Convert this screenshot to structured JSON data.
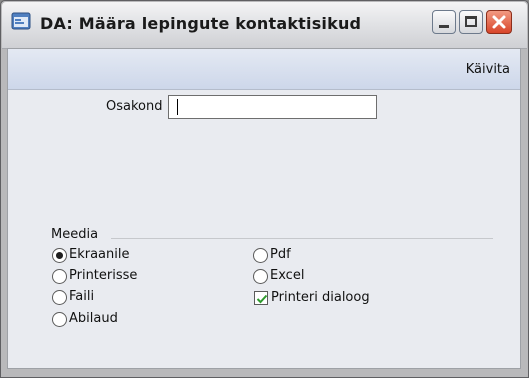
{
  "window": {
    "title": "DA: Määra lepingute kontaktisikud",
    "icon": "app-window-icon",
    "buttons": [
      "minimize-icon",
      "maximize-icon",
      "close-icon"
    ]
  },
  "toolbar": {
    "run_label": "Käivita"
  },
  "form": {
    "department_label": "Osakond",
    "department_value": ""
  },
  "media": {
    "label": "Meedia",
    "options": [
      {
        "label": "Ekraanile",
        "selected": true
      },
      {
        "label": "Printerisse",
        "selected": false
      },
      {
        "label": "Faili",
        "selected": false
      },
      {
        "label": "Abilaud",
        "selected": false
      },
      {
        "label": "Pdf",
        "selected": false
      },
      {
        "label": "Excel",
        "selected": false
      }
    ],
    "printer_dialog": {
      "label": "Printeri dialoog",
      "checked": true
    }
  },
  "colors": {
    "check_green": "#2e9a2e",
    "close_red": "#d8452a",
    "client_bg": "#e9ebf0"
  }
}
